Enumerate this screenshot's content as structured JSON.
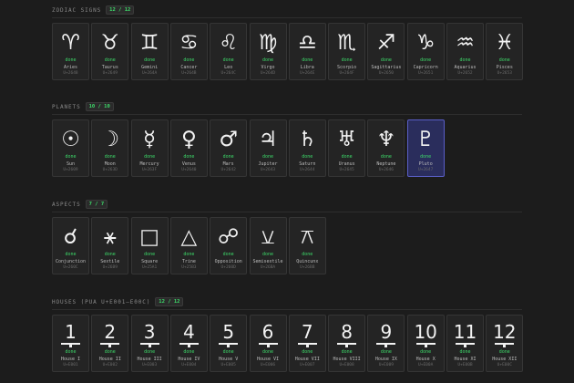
{
  "sections": [
    {
      "title": "ZODIAC SIGNS",
      "count": "12 / 12",
      "items": [
        {
          "glyph": "♈",
          "label": "Aries",
          "code": "U+2648",
          "status": "done"
        },
        {
          "glyph": "♉",
          "label": "Taurus",
          "code": "U+2649",
          "status": "done"
        },
        {
          "glyph": "♊",
          "label": "Gemini",
          "code": "U+264A",
          "status": "done"
        },
        {
          "glyph": "♋",
          "label": "Cancer",
          "code": "U+264B",
          "status": "done"
        },
        {
          "glyph": "♌",
          "label": "Leo",
          "code": "U+264C",
          "status": "done"
        },
        {
          "glyph": "♍",
          "label": "Virgo",
          "code": "U+264D",
          "status": "done"
        },
        {
          "glyph": "♎",
          "label": "Libra",
          "code": "U+264E",
          "status": "done"
        },
        {
          "glyph": "♏",
          "label": "Scorpio",
          "code": "U+264F",
          "status": "done"
        },
        {
          "glyph": "♐",
          "label": "Sagittarius",
          "code": "U+2650",
          "status": "done"
        },
        {
          "glyph": "♑",
          "label": "Capricorn",
          "code": "U+2651",
          "status": "done"
        },
        {
          "glyph": "♒",
          "label": "Aquarius",
          "code": "U+2652",
          "status": "done"
        },
        {
          "glyph": "♓",
          "label": "Pisces",
          "code": "U+2653",
          "status": "done"
        }
      ]
    },
    {
      "title": "PLANETS",
      "count": "10 / 10",
      "items": [
        {
          "glyph": "☉",
          "label": "Sun",
          "code": "U+2609",
          "status": "done"
        },
        {
          "glyph": "☽",
          "label": "Moon",
          "code": "U+263D",
          "status": "done"
        },
        {
          "glyph": "☿",
          "label": "Mercury",
          "code": "U+263F",
          "status": "done"
        },
        {
          "glyph": "♀",
          "label": "Venus",
          "code": "U+2640",
          "status": "done"
        },
        {
          "glyph": "♂",
          "label": "Mars",
          "code": "U+2642",
          "status": "done"
        },
        {
          "glyph": "♃",
          "label": "Jupiter",
          "code": "U+2643",
          "status": "done"
        },
        {
          "glyph": "♄",
          "label": "Saturn",
          "code": "U+2644",
          "status": "done"
        },
        {
          "glyph": "♅",
          "label": "Uranus",
          "code": "U+2645",
          "status": "done"
        },
        {
          "glyph": "♆",
          "label": "Neptune",
          "code": "U+2646",
          "status": "done"
        },
        {
          "glyph": "♇",
          "label": "Pluto",
          "code": "U+2647",
          "status": "done",
          "selected": true
        }
      ]
    },
    {
      "title": "ASPECTS",
      "count": "7 / 7",
      "items": [
        {
          "glyph": "☌",
          "label": "Conjunction",
          "code": "U+260C",
          "status": "done"
        },
        {
          "glyph": "⚹",
          "label": "Sextile",
          "code": "U+26B9",
          "status": "done"
        },
        {
          "glyph": "□",
          "label": "Square",
          "code": "U+25A1",
          "status": "done"
        },
        {
          "glyph": "△",
          "label": "Trine",
          "code": "U+25B3",
          "status": "done"
        },
        {
          "glyph": "☍",
          "label": "Opposition",
          "code": "U+260D",
          "status": "done"
        },
        {
          "glyph": "⚺",
          "label": "Semisextile",
          "code": "U+26BA",
          "status": "done"
        },
        {
          "glyph": "⚻",
          "label": "Quincunx",
          "code": "U+26BB",
          "status": "done"
        }
      ]
    },
    {
      "title": "HOUSES (PUA U+E001–E00C)",
      "count": "12 / 12",
      "items": [
        {
          "number": "1",
          "label": "House I",
          "code": "U+E001",
          "status": "done"
        },
        {
          "number": "2",
          "label": "House II",
          "code": "U+E002",
          "status": "done"
        },
        {
          "number": "3",
          "label": "House III",
          "code": "U+E003",
          "status": "done"
        },
        {
          "number": "4",
          "label": "House IV",
          "code": "U+E004",
          "status": "done"
        },
        {
          "number": "5",
          "label": "House V",
          "code": "U+E005",
          "status": "done"
        },
        {
          "number": "6",
          "label": "House VI",
          "code": "U+E006",
          "status": "done"
        },
        {
          "number": "7",
          "label": "House VII",
          "code": "U+E007",
          "status": "done"
        },
        {
          "number": "8",
          "label": "House VIII",
          "code": "U+E008",
          "status": "done"
        },
        {
          "number": "9",
          "label": "House IX",
          "code": "U+E009",
          "status": "done"
        },
        {
          "number": "10",
          "label": "House X",
          "code": "U+E00A",
          "status": "done"
        },
        {
          "number": "11",
          "label": "House XI",
          "code": "U+E00B",
          "status": "done"
        },
        {
          "number": "12",
          "label": "House XII",
          "code": "U+E00C",
          "status": "done"
        }
      ]
    }
  ],
  "colors": {
    "background": "#1c1c1c",
    "card": "#242424",
    "done": "#3ddc6a",
    "selected": "#2a2d5c"
  }
}
